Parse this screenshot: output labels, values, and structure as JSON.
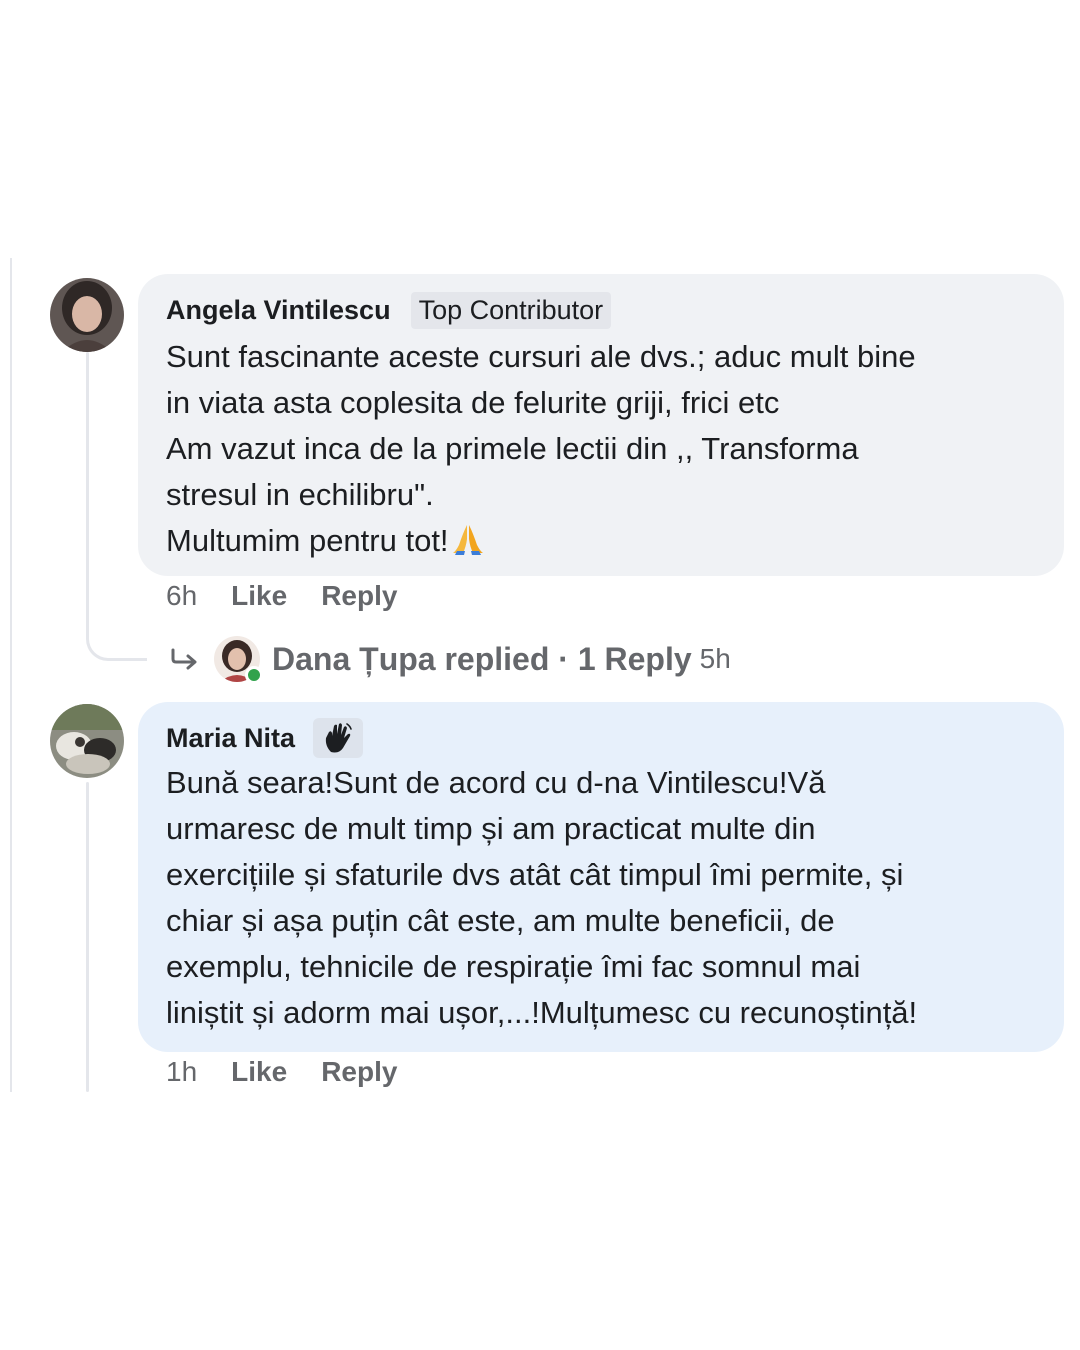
{
  "comments": [
    {
      "author": "Angela Vintilescu",
      "badge": "Top Contributor",
      "text": "Sunt fascinante aceste cursuri ale dvs.; aduc mult bine\nin viata asta coplesita de felurite griji, frici etc\nAm vazut inca de la primele lectii din ,, Transforma\nstresul in echilibru\".\nMultumim pentru tot!",
      "emoji": "folded-hands",
      "time": "6h",
      "like_label": "Like",
      "reply_label": "Reply",
      "replies": {
        "text": "Dana Țupa replied · 1 Reply",
        "time": "5h"
      }
    },
    {
      "author": "Maria Nita",
      "badge_icon": "waving-hand",
      "text": "Bună seara!Sunt de acord cu d-na Vintilescu!Vă\nurmaresc de mult timp și am practicat multe din\nexercițiile și sfaturile dvs atât cât timpul îmi permite, și\nchiar și așa puțin cât este, am multe beneficii, de\nexemplu, tehnicile de respirație îmi fac somnul mai\nliniștit și adorm mai ușor,...!Mulțumesc cu recunoștință!",
      "time": "1h",
      "like_label": "Like",
      "reply_label": "Reply"
    }
  ],
  "colors": {
    "bubble_grey": "#f0f2f5",
    "bubble_blue": "#e7f0fb",
    "meta_text": "#65676b",
    "online": "#31a24c"
  }
}
